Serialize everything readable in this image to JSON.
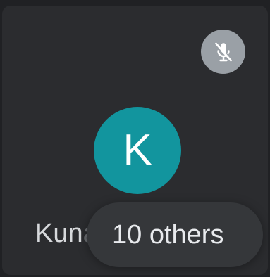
{
  "participant": {
    "initial": "K",
    "name_visible": "Kun",
    "name_faded": "al",
    "avatar_color": "#12959e",
    "muted": true
  },
  "others_button": {
    "label": "10 others"
  },
  "icons": {
    "mute_indicator": "mic-off-icon"
  }
}
